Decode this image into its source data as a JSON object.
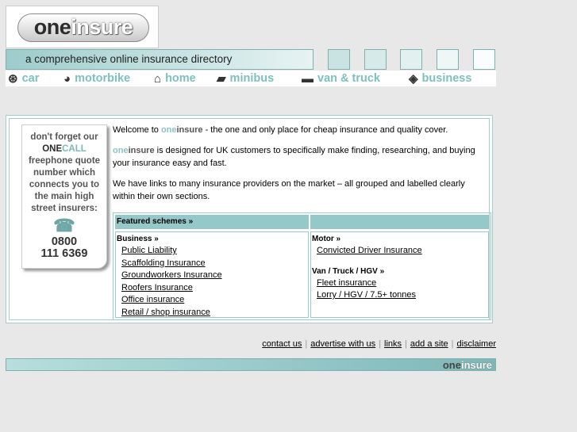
{
  "logo": {
    "one": "one",
    "insure": "insure"
  },
  "tagline": "a comprehensive online insurance directory",
  "nav": [
    {
      "label": "car",
      "icon": "steering-wheel-icon"
    },
    {
      "label": "motorbike",
      "icon": "helmet-icon"
    },
    {
      "label": "home",
      "icon": "house-icon"
    },
    {
      "label": "minibus",
      "icon": "minibus-icon"
    },
    {
      "label": "van & truck",
      "icon": "truck-icon"
    },
    {
      "label": "business",
      "icon": "handshake-icon"
    }
  ],
  "promo": {
    "line1": "don't forget our",
    "one": "ONE",
    "call": "CALL",
    "line2": "freephone quote number which connects you to the main high street insurers:",
    "phone1": "0800",
    "phone2": "111 6369"
  },
  "intro": {
    "p1_pre": "Welcome to ",
    "brand_one": "one",
    "brand_insure": "insure",
    "p1_post": " - the one and only place for cheap insurance and quality cover.",
    "p2_post": " is designed for UK customers to specifically make finding, researching, and buying your insurance easy and fast.",
    "p3": "We have links to many insurance providers on the market – all grouped and labelled clearly within their own sections."
  },
  "schemes": {
    "header": "Featured schemes »",
    "business_label": "Business »",
    "business_links": [
      "Public Liability",
      "Scaffolding Insurance ",
      "Groundworkers Insurance",
      "Roofers Insurance",
      "Office insurance",
      "Retail / shop insurance"
    ],
    "motor_label": "Motor »",
    "motor_links": [
      "Convicted Driver Insurance"
    ],
    "van_label": "Van / Truck / HGV »",
    "van_links": [
      "Fleet insurance ",
      "Lorry / HGV / 7.5+ tonnes"
    ]
  },
  "footer": {
    "links": [
      "contact us",
      "advertise with us",
      "links",
      "add a site",
      "disclaimer"
    ],
    "separators": [
      "|",
      "|",
      "|",
      "|"
    ],
    "logo_one": "one",
    "logo_insure": "insure"
  },
  "colors": {
    "accent": "#95c9c9",
    "nav_text": "#7ec0c0",
    "background": "#e8e8e8"
  }
}
